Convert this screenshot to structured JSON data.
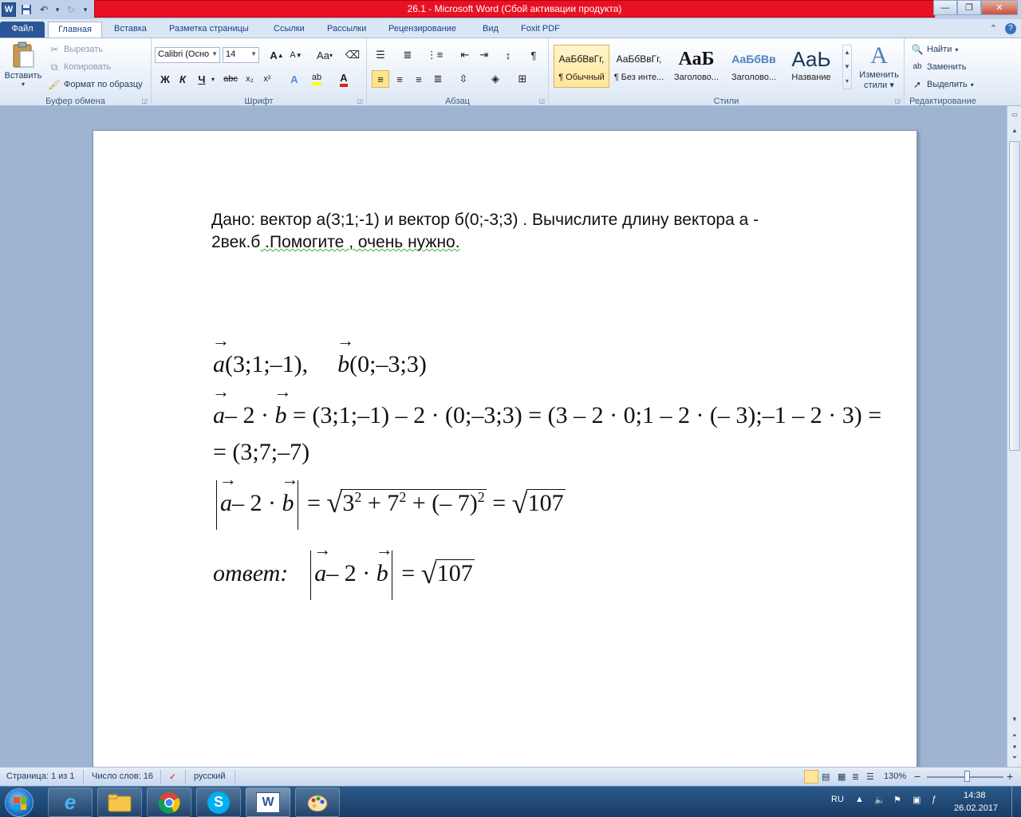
{
  "window": {
    "title": "26.1  -  Microsoft Word (Сбой активации продукта)",
    "app_logo": "W",
    "buttons": {
      "minimize": "—",
      "restore": "❐",
      "close": "✕"
    }
  },
  "qat": {
    "undo_glyph": "↶",
    "redo_glyph": "↻",
    "customize_glyph": "▾"
  },
  "tabs": [
    {
      "label": "Файл"
    },
    {
      "label": "Главная"
    },
    {
      "label": "Вставка"
    },
    {
      "label": "Разметка страницы"
    },
    {
      "label": "Ссылки"
    },
    {
      "label": "Рассылки"
    },
    {
      "label": "Рецензирование"
    },
    {
      "label": "Вид"
    },
    {
      "label": "Foxit PDF"
    }
  ],
  "ribbon": {
    "clipboard": {
      "label": "Буфер обмена",
      "paste": "Вставить",
      "cut": "Вырезать",
      "copy": "Копировать",
      "format_painter": "Формат по образцу"
    },
    "font": {
      "label": "Шрифт",
      "font_name": "Calibri (Осно",
      "font_size": "14",
      "bold": "Ж",
      "italic": "К",
      "underline": "Ч",
      "strike": "abc",
      "subscript": "x₂",
      "superscript": "x²",
      "grow": "A",
      "shrink": "A",
      "case": "Aa",
      "color_a": "A"
    },
    "paragraph": {
      "label": "Абзац",
      "pilcrow": "¶"
    },
    "styles": {
      "label": "Стили",
      "items": [
        {
          "sample": "АаБбВвГг,",
          "name": "¶ Обычный"
        },
        {
          "sample": "АаБбВвГг,",
          "name": "¶ Без инте..."
        },
        {
          "sample": "АаБ",
          "name": "Заголово..."
        },
        {
          "sample": "АаБбВв",
          "name": "Заголово..."
        },
        {
          "sample": "АаЬ",
          "name": "Название"
        }
      ],
      "change_styles": "Изменить",
      "change_styles_2": "стили"
    },
    "editing": {
      "label": "Редактирование",
      "find": "Найти",
      "replace": "Заменить",
      "select": "Выделить"
    }
  },
  "document": {
    "question_line1": "Дано: вектор а(3;1;-1) и вектор б(0;-3;3) . Вычислите длину вектора а -",
    "question_line2_a": "2век.б",
    "question_line2_b": " .Помогите , очень нужно.",
    "m1_a": "a",
    "m1_a_rest": "(3;1;–1),",
    "m1_b": "b",
    "m1_b_rest": "(0;–3;3)",
    "m2_a": "a",
    "m2_mid": "– 2 · ",
    "m2_b": "b",
    "m2_rest": " = (3;1;–1) – 2 · (0;–3;3) = (3 – 2 · 0;1 – 2 · (– 3);–1 – 2 · 3) =",
    "m3": "= (3;7;–7)",
    "m4_a": "a",
    "m4_mid": "– 2 · ",
    "m4_b": "b",
    "m4_eq": " = ",
    "m4_radicand_1": "3",
    "m4_radicand_2": " + 7",
    "m4_radicand_3": " + (– 7)",
    "m4_sup": "2",
    "m4_eq2": " = ",
    "m4_result": "107",
    "m5_label": "ответ:",
    "m5_a": "a",
    "m5_mid": "– 2 · ",
    "m5_b": "b",
    "m5_eq": " = ",
    "m5_result": "107"
  },
  "status": {
    "page": "Страница: 1 из 1",
    "words": "Число слов: 16",
    "lang": "русский",
    "zoom": "130%",
    "zoom_minus": "−",
    "zoom_plus": "+"
  },
  "taskbar": {
    "lang": "RU",
    "time": "14:38",
    "date": "26.02.2017",
    "apps": [
      "ie",
      "explorer",
      "chrome",
      "skype",
      "word",
      "paint"
    ]
  },
  "colors": {
    "title_warning": "#e81123",
    "file_tab": "#2a5597",
    "taskbar": "#1f4a78"
  }
}
